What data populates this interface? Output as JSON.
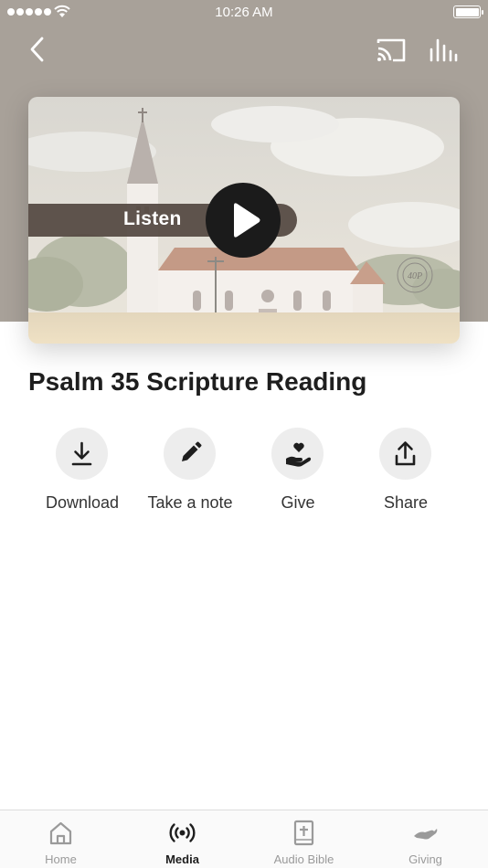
{
  "status_bar": {
    "time": "10:26 AM"
  },
  "header": {
    "back_icon": "chevron-left-icon",
    "cast_icon": "cast-icon",
    "audio_icon": "equalizer-icon"
  },
  "player": {
    "listen_label": "Listen",
    "play_icon": "play-icon",
    "seal_text": "40P"
  },
  "media": {
    "title": "Psalm 35 Scripture Reading"
  },
  "actions": [
    {
      "label": "Download",
      "icon": "download-icon"
    },
    {
      "label": "Take a note",
      "icon": "pencil-icon"
    },
    {
      "label": "Give",
      "icon": "hand-heart-icon"
    },
    {
      "label": "Share",
      "icon": "share-icon"
    }
  ],
  "tabbar": {
    "active": "Media",
    "tabs": [
      {
        "label": "Home",
        "icon": "home-icon"
      },
      {
        "label": "Media",
        "icon": "broadcast-icon"
      },
      {
        "label": "Audio Bible",
        "icon": "bible-icon"
      },
      {
        "label": "Giving",
        "icon": "giving-icon"
      }
    ]
  },
  "colors": {
    "hero_background": "#a8a199",
    "listen_bar": "#524640",
    "play_button": "#1b1b1b",
    "action_circle": "#ededed",
    "tab_active": "#1e1e1e",
    "tab_inactive": "#9a9a9a"
  }
}
